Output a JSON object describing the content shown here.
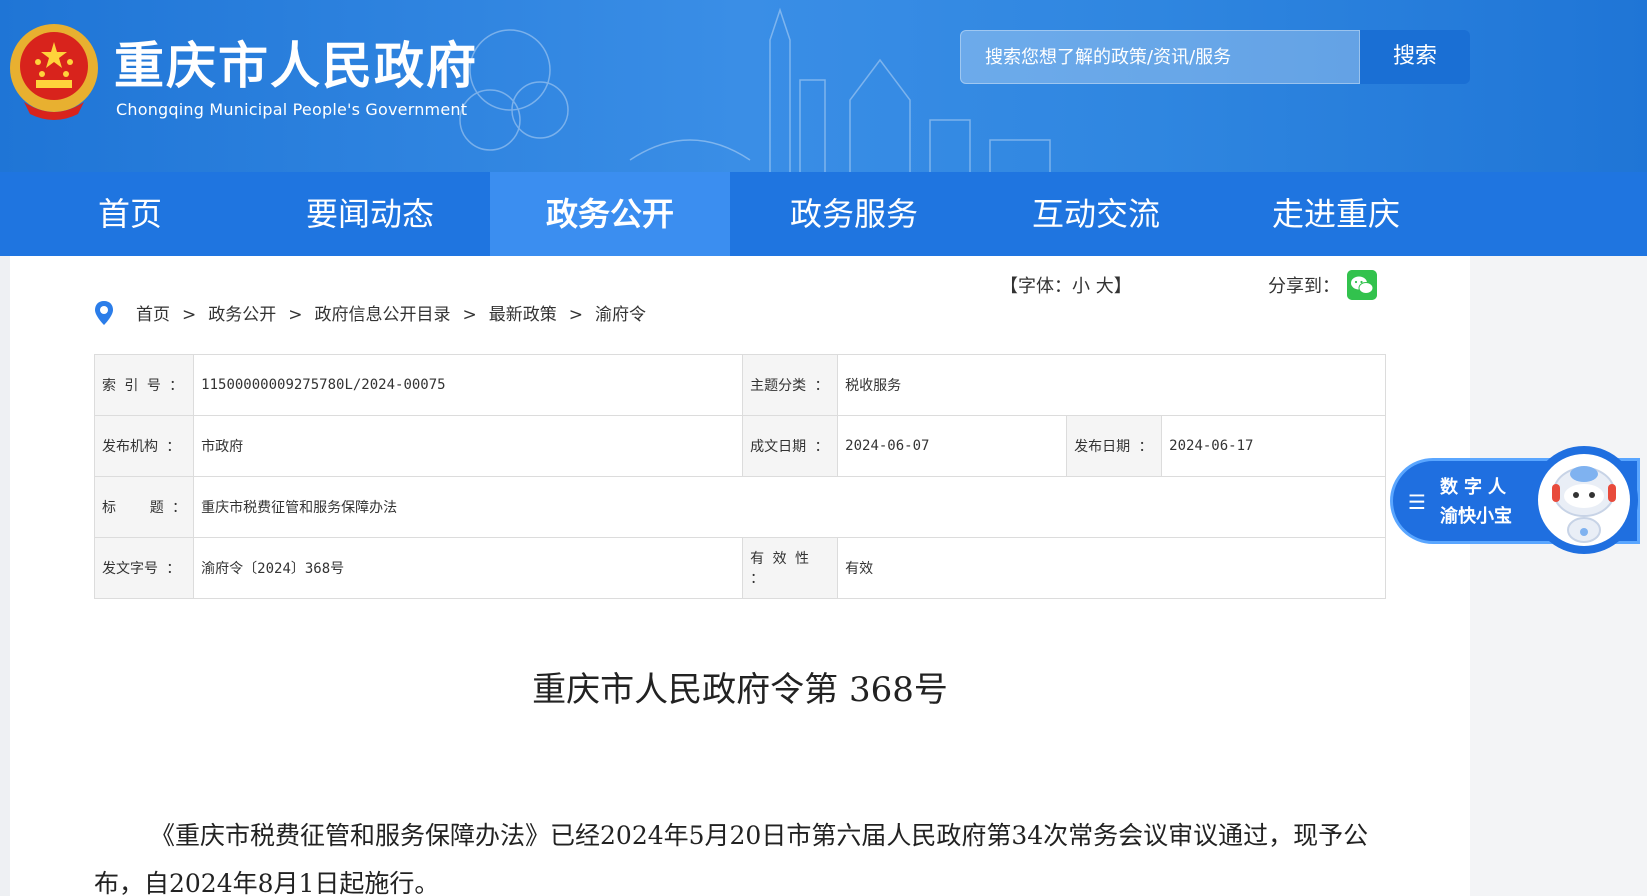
{
  "header": {
    "title": "重庆市人民政府",
    "subtitle": "Chongqing Municipal People's Government",
    "search_placeholder": "搜索您想了解的政策/资讯/服务",
    "search_button": "搜索"
  },
  "nav": {
    "items": [
      "首页",
      "要闻动态",
      "政务公开",
      "政务服务",
      "互动交流",
      "走进重庆"
    ],
    "active_index": 2
  },
  "breadcrumb": [
    "首页",
    "政务公开",
    "政府信息公开目录",
    "最新政策",
    "渝府令"
  ],
  "breadcrumb_sep": ">",
  "font_size_control": "【字体：小 大】",
  "share_label": "分享到：",
  "info": {
    "index_label": "索 引 号 ：",
    "index_value": "11500000009275780L/2024-00075",
    "topic_label": "主题分类 ：",
    "topic_value": "税收服务",
    "publisher_label": "发布机构 ：",
    "publisher_value": "市政府",
    "written_label": "成文日期 ：",
    "written_value": "2024-06-07",
    "released_label": "发布日期 ：",
    "released_value": "2024-06-17",
    "title_label": "标    题 ：",
    "title_value": "重庆市税费征管和服务保障办法",
    "docno_label": "发文字号 ：",
    "docno_value": "渝府令〔2024〕368号",
    "validity_label": "有 效 性 ：",
    "validity_value": "有效"
  },
  "document": {
    "heading": "重庆市人民政府令第 368号",
    "paragraph": "《重庆市税费征管和服务保障办法》已经2024年5月20日市第六届人民政府第34次常务会议审议通过，现予公布，自2024年8月1日起施行。"
  },
  "assistant": {
    "line1": "数字人",
    "line2": "渝快小宝"
  },
  "colors": {
    "banner": "#2f86e0",
    "nav": "#1f75e0",
    "nav_active": "#3b8ef0",
    "wechat": "#32c24d"
  },
  "icons": [
    "national-emblem-icon",
    "location-pin-icon",
    "wechat-icon",
    "menu-icon",
    "robot-avatar-icon"
  ]
}
